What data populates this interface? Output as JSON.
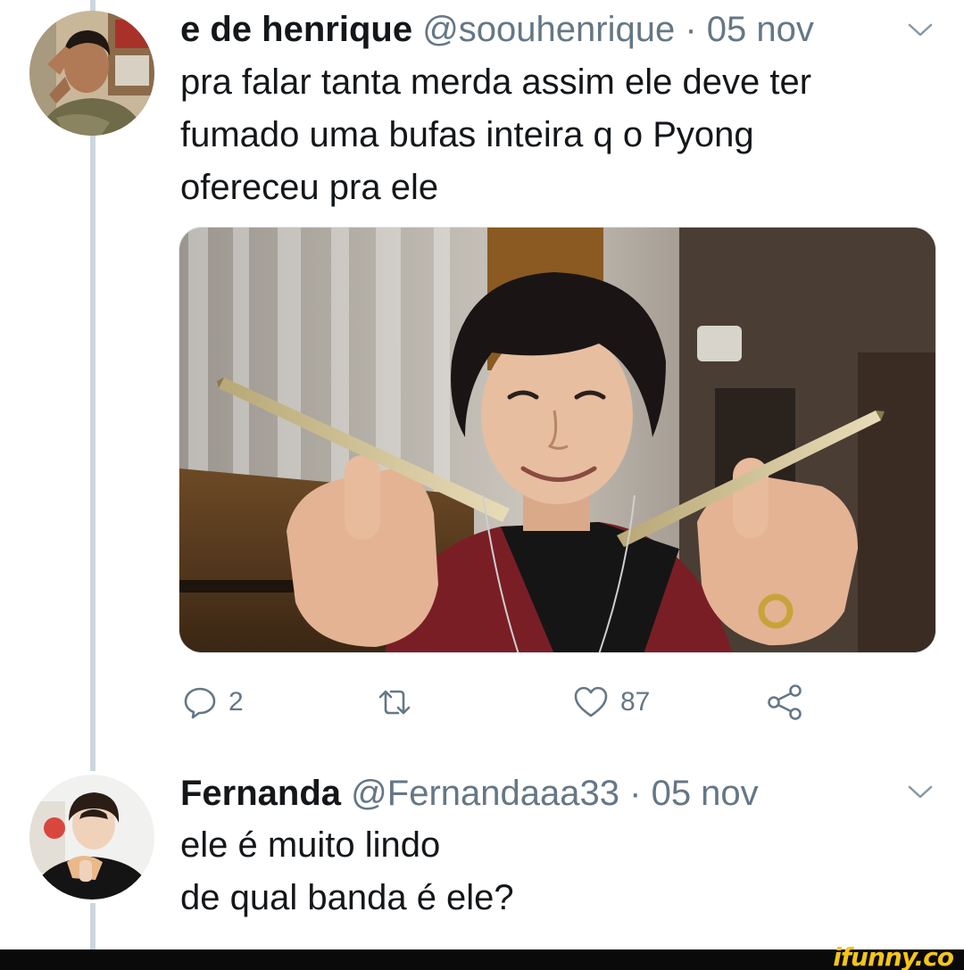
{
  "tweet": {
    "author_name": "e de henrique",
    "author_handle": "@soouhenrique",
    "separator": "·",
    "timestamp": "05 nov",
    "text_lines": [
      "pra falar tanta merda assim ele deve ter",
      "fumado uma bufas inteira q o Pyong",
      "ofereceu pra ele"
    ],
    "reply_count": "2",
    "retweet_count": "",
    "like_count": "87"
  },
  "reply": {
    "author_name": "Fernanda",
    "author_handle": "@Fernandaaa33",
    "separator": "·",
    "timestamp": "05 nov",
    "text_lines": [
      "ele é muito lindo",
      "de qual banda é ele?"
    ]
  },
  "watermark": {
    "brand": "ifunny.co"
  },
  "colors": {
    "text_primary": "#14171a",
    "text_secondary": "#657786",
    "thread_line": "#ccd6dd",
    "footer": "#0a0a0a",
    "watermark": "#f5c518"
  },
  "icons": {
    "reply": "reply-icon",
    "retweet": "retweet-icon",
    "like": "heart-icon",
    "share": "share-icon",
    "more": "chevron-down-icon"
  }
}
